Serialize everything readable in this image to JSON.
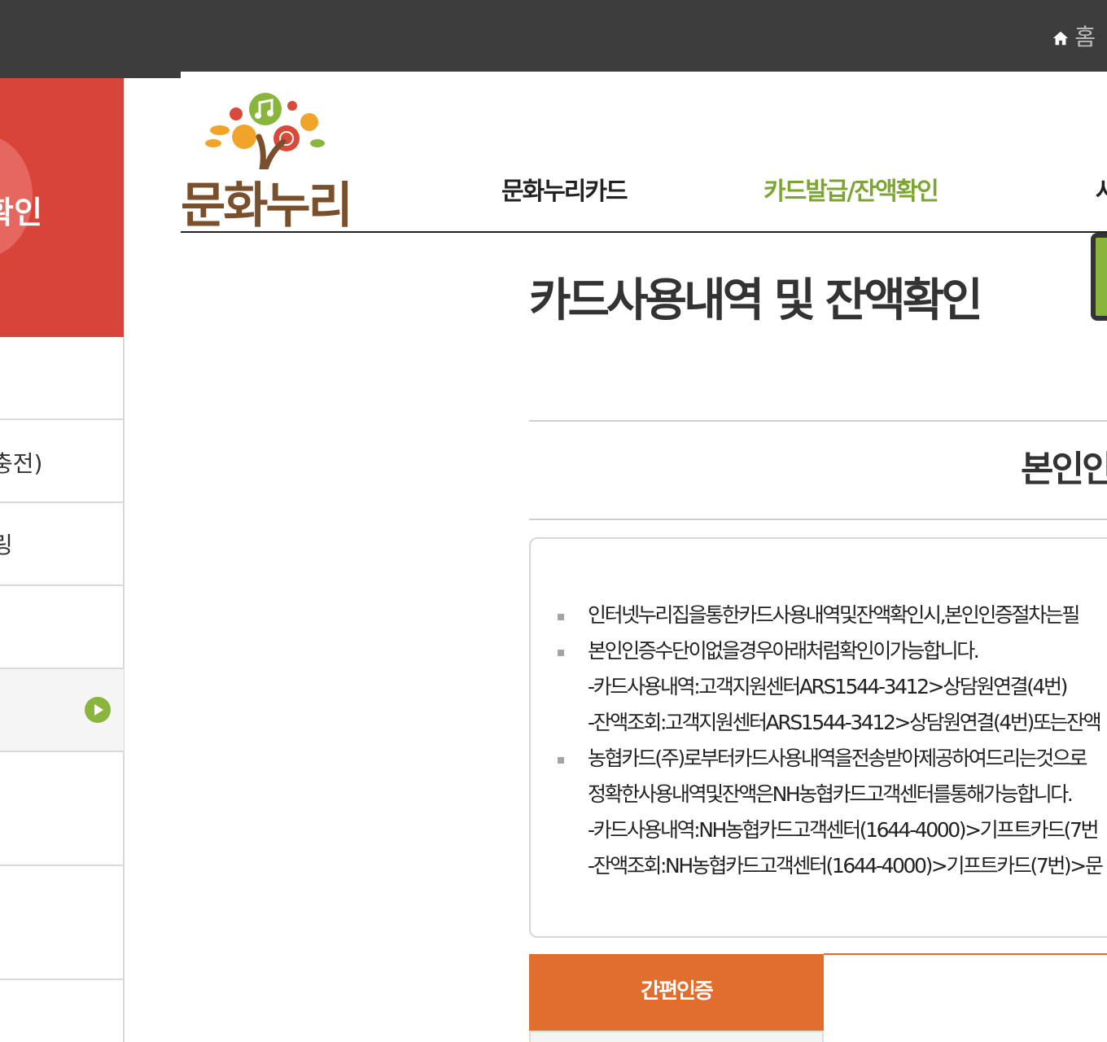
{
  "top_bar": {
    "home_label": "홈",
    "home_icon": "home-icon"
  },
  "header": {
    "logo_text": "문화누리",
    "nav": [
      {
        "label": "문화누리카드",
        "active": false
      },
      {
        "label": "카드발급/잔액확인",
        "active": true
      },
      {
        "label": "사",
        "active": false
      }
    ],
    "accent_color": "#7da531"
  },
  "sidebar": {
    "banner_text": "확인",
    "banner_color": "#d9443a",
    "items": [
      {
        "label": ""
      },
      {
        "label": "충전)"
      },
      {
        "label": "링"
      },
      {
        "label": ""
      },
      {
        "label": "",
        "active": true,
        "icon": "play-circle-icon"
      },
      {
        "label": ""
      },
      {
        "label": ""
      },
      {
        "label": ""
      }
    ]
  },
  "main": {
    "page_title": "카드사용내역 및 잔액확인",
    "section_title": "본인인",
    "info_lines": [
      "인터넷누리집을통한카드사용내역및잔액확인시,본인인증절차는필",
      "본인인증수단이없을경우아래처럼확인이가능합니다.",
      "-카드사용내역:고객지원센터ARS1544-3412>상담원연결(4번)",
      "-잔액조회:고객지원센터ARS1544-3412>상담원연결(4번)또는잔액",
      "농협카드(주)로부터카드사용내역을전송받아제공하여드리는것으로",
      "정확한사용내역및잔액은NH농협카드고객센터를통해가능합니다.",
      "-카드사용내역:NH농협카드고객센터(1644-4000)>기프트카드(7번",
      "-잔액조회:NH농협카드고객센터(1644-4000)>기프트카드(7번)>문"
    ],
    "tabs": [
      {
        "label": "간편인증",
        "active": true
      }
    ],
    "tab_color": "#e06e2e"
  }
}
